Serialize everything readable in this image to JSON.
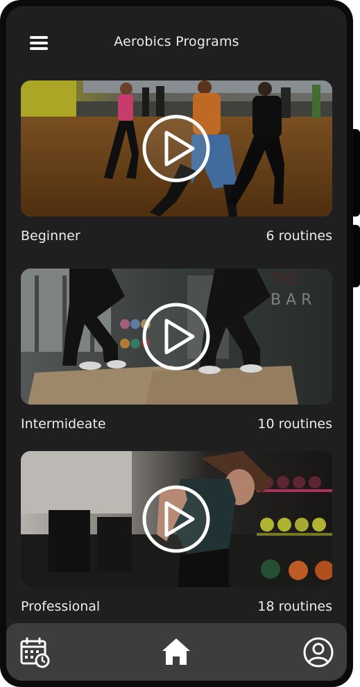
{
  "header": {
    "title": "Aerobics Programs",
    "menu_icon": "hamburger-menu-icon"
  },
  "programs": [
    {
      "label": "Beginner",
      "count": "6 routines",
      "thumbnail": "dance-class-photo"
    },
    {
      "label": "Intermideate",
      "count": "10 routines",
      "thumbnail": "box-jump-photo"
    },
    {
      "label": "Professional",
      "count": "18 routines",
      "thumbnail": "gym-kettlebell-photo"
    }
  ],
  "bottom_nav": {
    "items": [
      {
        "icon": "calendar-clock-icon"
      },
      {
        "icon": "home-icon",
        "active": true
      },
      {
        "icon": "profile-icon"
      }
    ]
  },
  "colors": {
    "screen_bg": "#1f1f1f",
    "nav_bg": "#3d3d3d",
    "text": "#ededed"
  }
}
